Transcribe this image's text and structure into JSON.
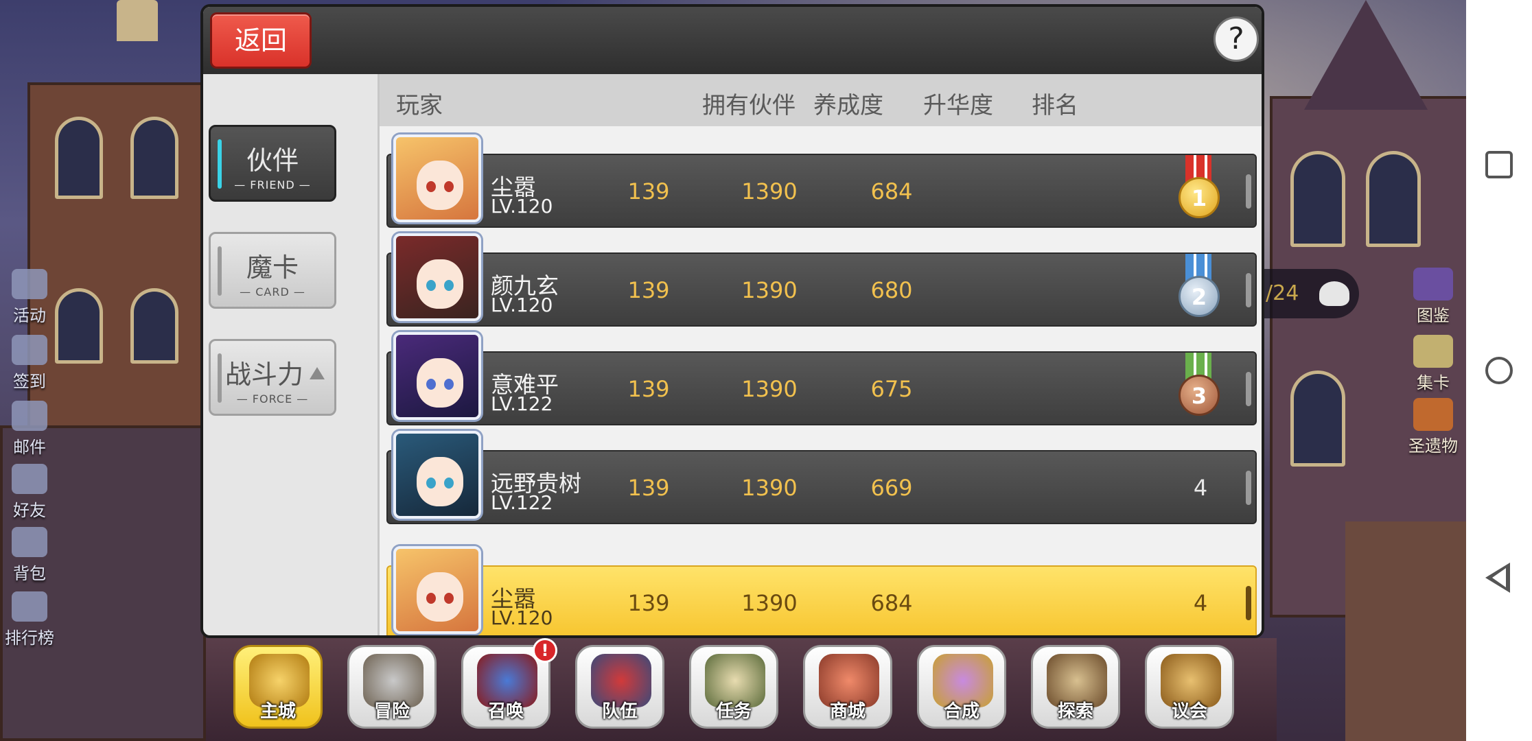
{
  "panel": {
    "back_label": "返回",
    "help_label": "?"
  },
  "tabs": [
    {
      "label": "伙伴",
      "sub": "FRIEND",
      "active": true
    },
    {
      "label": "魔卡",
      "sub": "CARD",
      "active": false
    },
    {
      "label": "战斗力",
      "sub": "FORCE",
      "active": false
    }
  ],
  "table": {
    "headers": {
      "player": "玩家",
      "owned": "拥有伙伴",
      "training": "养成度",
      "ascension": "升华度",
      "rank": "排名"
    },
    "rows": [
      {
        "name": "尘嚣",
        "level": "LV.120",
        "owned": "139",
        "training": "1390",
        "ascension": "684",
        "rank": "1",
        "medal": "gold"
      },
      {
        "name": "颜九玄",
        "level": "LV.120",
        "owned": "139",
        "training": "1390",
        "ascension": "680",
        "rank": "2",
        "medal": "silver"
      },
      {
        "name": "意难平",
        "level": "LV.122",
        "owned": "139",
        "training": "1390",
        "ascension": "675",
        "rank": "3",
        "medal": "bronze"
      },
      {
        "name": "远野贵树",
        "level": "LV.122",
        "owned": "139",
        "training": "1390",
        "ascension": "669",
        "rank": "4",
        "medal": ""
      }
    ],
    "self_row": {
      "name": "尘嚣",
      "level": "LV.120",
      "owned": "139",
      "training": "1390",
      "ascension": "684",
      "rank": "4"
    }
  },
  "left_menu": [
    {
      "label": "活动",
      "icon": "megaphone-icon"
    },
    {
      "label": "签到",
      "icon": "calendar-check-icon"
    },
    {
      "label": "邮件",
      "icon": "mail-icon"
    },
    {
      "label": "好友",
      "icon": "friends-icon"
    },
    {
      "label": "背包",
      "icon": "bag-icon"
    },
    {
      "label": "排行榜",
      "icon": "ranking-bars-icon"
    }
  ],
  "right_menu": [
    {
      "label": "图鉴",
      "icon": "book-icon"
    },
    {
      "label": "集卡",
      "icon": "card-collect-icon"
    },
    {
      "label": "圣遗物",
      "icon": "relic-icon"
    }
  ],
  "counter": {
    "text": "/24",
    "icon": "ghost-icon"
  },
  "dock": [
    {
      "label": "主城",
      "icon": "crown-icon",
      "active": true
    },
    {
      "label": "冒险",
      "icon": "swords-icon",
      "active": false
    },
    {
      "label": "召唤",
      "icon": "summon-card-icon",
      "active": false,
      "badge": "!"
    },
    {
      "label": "队伍",
      "icon": "winged-shield-icon",
      "active": false
    },
    {
      "label": "任务",
      "icon": "scroll-book-icon",
      "active": false
    },
    {
      "label": "商城",
      "icon": "shop-tree-icon",
      "active": false
    },
    {
      "label": "合成",
      "icon": "potion-icon",
      "active": false
    },
    {
      "label": "探索",
      "icon": "shovel-icon",
      "active": false
    },
    {
      "label": "议会",
      "icon": "council-emblem-icon",
      "active": false
    }
  ],
  "colors": {
    "accent_gold": "#f2c14e",
    "back_red": "#d9322a",
    "tab_active_bar": "#39d3e8",
    "self_row": "#f7c52f"
  }
}
